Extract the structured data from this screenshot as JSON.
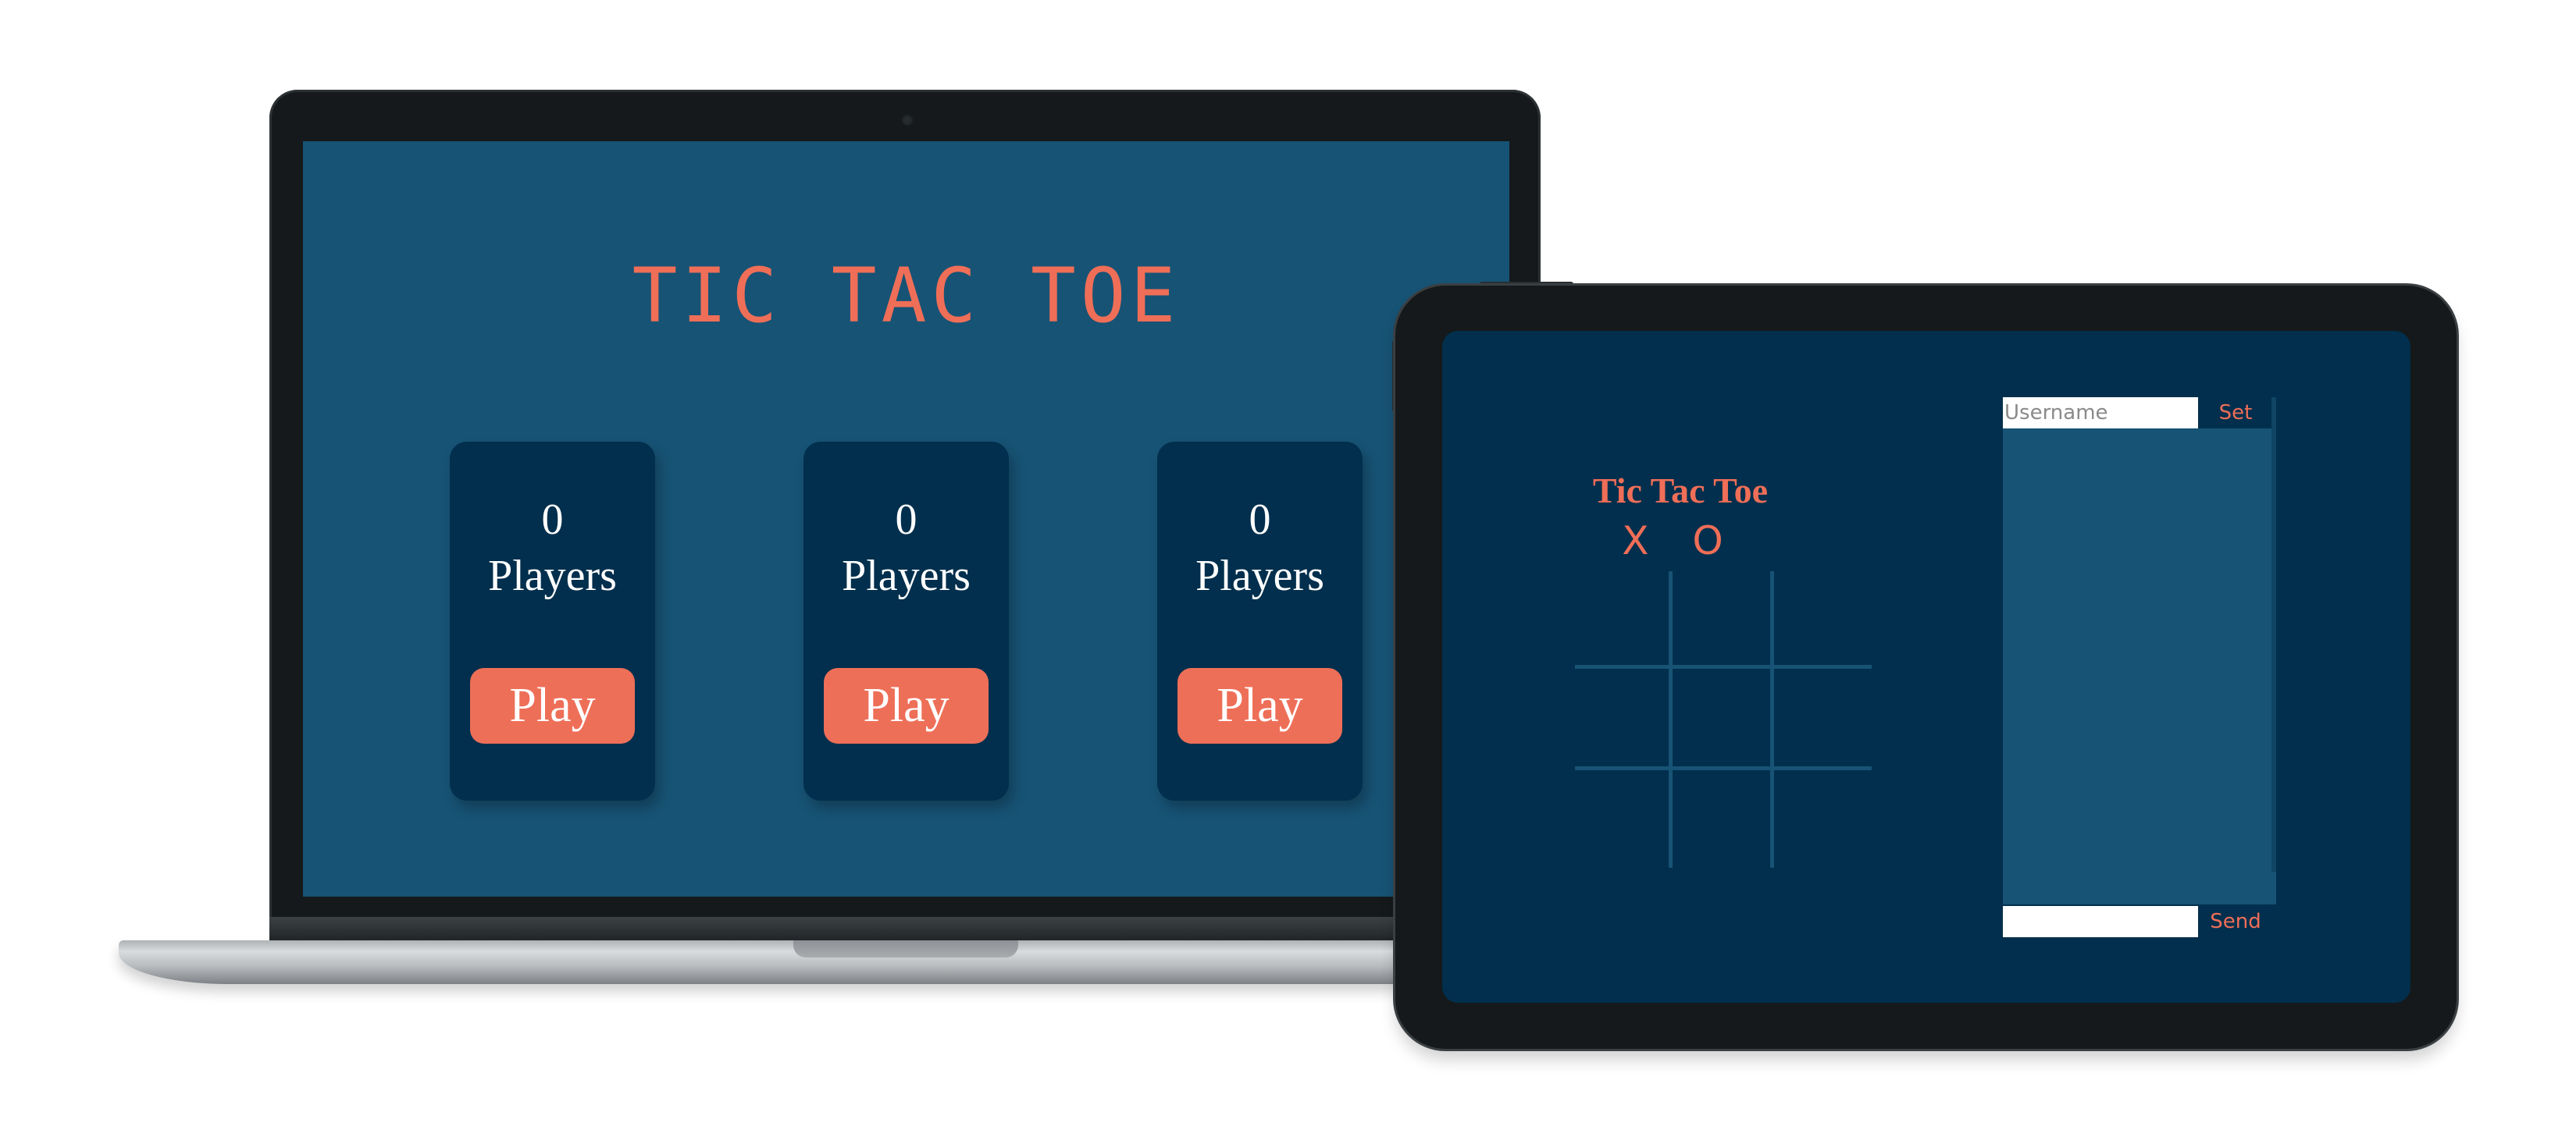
{
  "colors": {
    "screen_bg_light": "#175375",
    "screen_bg_dark": "#012f4d",
    "accent": "#ee6f58",
    "text_light": "#ffffff",
    "device_frame": "#15191b"
  },
  "laptop": {
    "title": "TIC TAC TOE",
    "rooms": [
      {
        "count": "0",
        "label": "Players",
        "button": "Play"
      },
      {
        "count": "0",
        "label": "Players",
        "button": "Play"
      },
      {
        "count": "0",
        "label": "Players",
        "button": "Play"
      }
    ]
  },
  "tablet": {
    "game": {
      "title": "Tic Tac Toe",
      "markers": "X O"
    },
    "chat": {
      "username_placeholder": "Username",
      "set_label": "Set",
      "message_value": "",
      "send_label": "Send"
    }
  }
}
